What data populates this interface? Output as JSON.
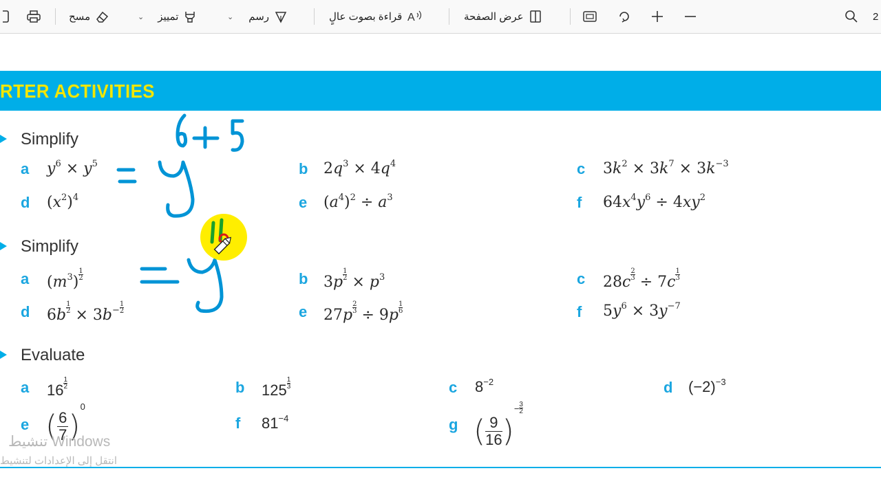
{
  "toolbar": {
    "page_number": "2",
    "zoom_out_icon": "minus-icon",
    "zoom_in_icon": "plus-icon",
    "erase_label": "مسح",
    "highlight_label": "تمييز",
    "draw_label": "رسم",
    "read_aloud_label": "قراءة بصوت عالٍ",
    "page_view_label": "عرض الصفحة"
  },
  "page": {
    "banner_title": "RTER ACTIVITIES",
    "sections": [
      {
        "heading": "Simplify",
        "items": [
          {
            "label": "a",
            "expr": "y⁶ × y⁵"
          },
          {
            "label": "b",
            "expr": "2q³ × 4q⁴"
          },
          {
            "label": "c",
            "expr": "3k² × 3k⁷ × 3k⁻³"
          },
          {
            "label": "d",
            "expr": "(x²)⁴"
          },
          {
            "label": "e",
            "expr": "(a⁴)² ÷ a³"
          },
          {
            "label": "f",
            "expr": "64x⁴y⁶ ÷ 4xy²"
          }
        ]
      },
      {
        "heading": "Simplify",
        "items": [
          {
            "label": "a",
            "expr": "(m³)^(1/2)"
          },
          {
            "label": "b",
            "expr": "3p^(1/2) × p³"
          },
          {
            "label": "c",
            "expr": "28c^(2/3) ÷ 7c^(1/3)"
          },
          {
            "label": "d",
            "expr": "6b^(1/2) × 3b^(-1/2)"
          },
          {
            "label": "e",
            "expr": "27p^(2/3) ÷ 9p^(1/6)"
          },
          {
            "label": "f",
            "expr": "5y⁶ × 3y⁻⁷"
          }
        ]
      },
      {
        "heading": "Evaluate",
        "items": [
          {
            "label": "a",
            "expr": "16^(1/2)"
          },
          {
            "label": "b",
            "expr": "125^(1/3)"
          },
          {
            "label": "c",
            "expr": "8⁻²"
          },
          {
            "label": "d",
            "expr": "(−2)⁻³"
          },
          {
            "label": "e",
            "expr": "(6/7)⁰"
          },
          {
            "label": "f",
            "expr": "81⁻⁴"
          },
          {
            "label": "g",
            "expr": "(9/16)^(-3/2)"
          }
        ]
      }
    ]
  },
  "annotations": {
    "handwritten": [
      "6 + 5",
      "= y",
      "= y",
      "11"
    ],
    "ink_color": "#0094d6",
    "pointer_color": "#ffee00"
  },
  "watermark": {
    "line1": "تنشيط Windows",
    "line2": "انتقل إلى الإعدادات لتنشيط"
  },
  "colors": {
    "banner": "#00aee8",
    "banner_text": "#f3e600",
    "question_label": "#1ba6e0"
  }
}
